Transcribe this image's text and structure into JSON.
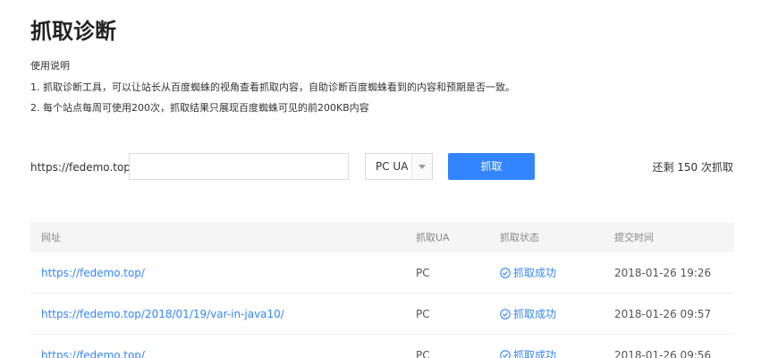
{
  "page": {
    "title": "抓取诊断",
    "usage_heading": "使用说明",
    "usage_lines": [
      "1. 抓取诊断工具，可以让站长从百度蜘蛛的视角查看抓取内容，自助诊断百度蜘蛛看到的内容和预期是否一致。",
      "2. 每个站点每周可使用200次，抓取结果只展现百度蜘蛛可见的前200KB内容"
    ]
  },
  "form": {
    "url_prefix": "https://fedemo.top/",
    "path_value": "",
    "ua_selected": "PC UA",
    "crawl_button": "抓取",
    "remaining_text": "还剩 150 次抓取"
  },
  "table": {
    "headers": [
      "网址",
      "抓取UA",
      "抓取状态",
      "提交时间"
    ],
    "rows": [
      {
        "url": "https://fedemo.top/",
        "ua": "PC",
        "status": "抓取成功",
        "time": "2018-01-26 19:26"
      },
      {
        "url": "https://fedemo.top/2018/01/19/var-in-java10/",
        "ua": "PC",
        "status": "抓取成功",
        "time": "2018-01-26 09:57"
      },
      {
        "url": "https://fedemo.top/",
        "ua": "PC",
        "status": "抓取成功",
        "time": "2018-01-26 09:56"
      }
    ]
  },
  "colors": {
    "accent": "#3385ff",
    "header_bg": "#f5f5f5",
    "border": "#d9d9d9"
  },
  "icons": {
    "status": "check-circle-icon",
    "select": "caret-down-icon"
  }
}
